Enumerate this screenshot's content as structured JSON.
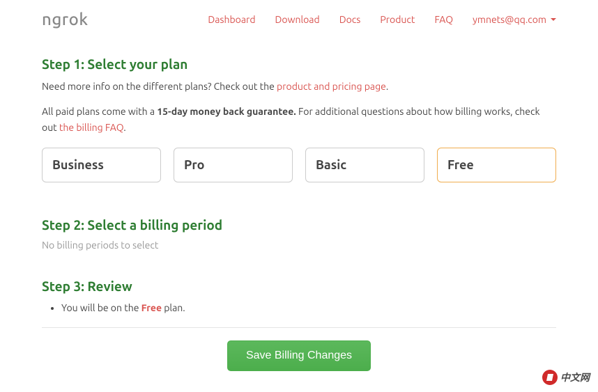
{
  "header": {
    "logo": "ngrok",
    "nav": {
      "dashboard": "Dashboard",
      "download": "Download",
      "docs": "Docs",
      "product": "Product",
      "faq": "FAQ"
    },
    "user_email": "ymnets@qq.com"
  },
  "step1": {
    "title": "Step 1: Select your plan",
    "intro_prefix": "Need more info on the different plans? Check out the ",
    "intro_link": "product and pricing page",
    "intro_suffix": ".",
    "guarantee_prefix": "All paid plans come with a ",
    "guarantee_bold": "15-day money back guarantee.",
    "guarantee_suffix_1": " For additional questions about how billing works, check out ",
    "guarantee_link": "the billing FAQ",
    "guarantee_suffix_2": ".",
    "plans": {
      "business": "Business",
      "pro": "Pro",
      "basic": "Basic",
      "free": "Free"
    }
  },
  "step2": {
    "title": "Step 2: Select a billing period",
    "no_periods": "No billing periods to select"
  },
  "step3": {
    "title": "Step 3: Review",
    "review_prefix": "You will be on the ",
    "review_plan": "Free",
    "review_suffix": " plan."
  },
  "save_button": "Save Billing Changes",
  "watermark": "中文网"
}
